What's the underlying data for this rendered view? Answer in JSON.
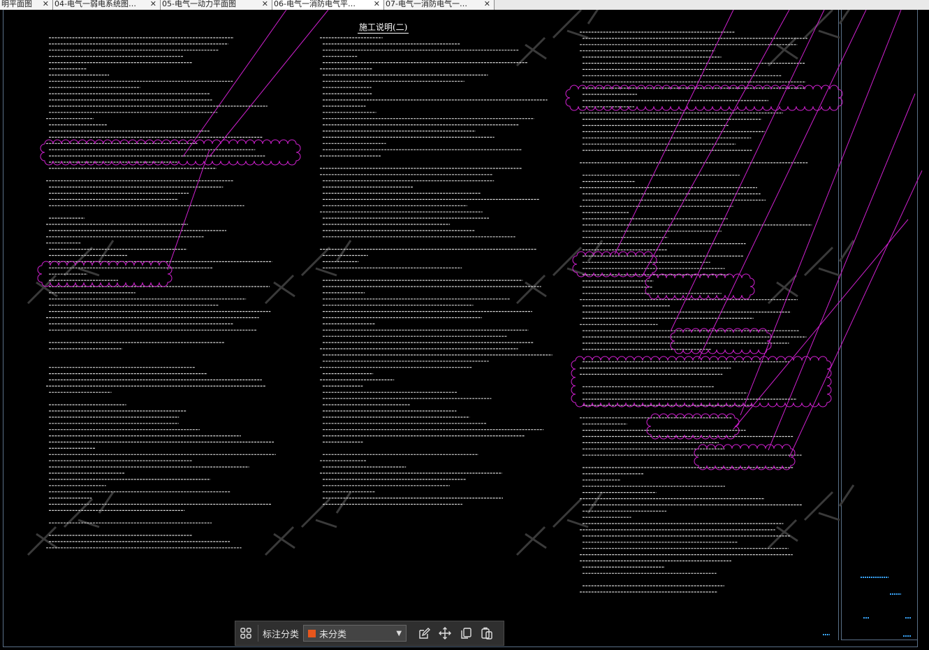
{
  "tabs": [
    {
      "label": "明平面图",
      "close": "✕"
    },
    {
      "label": "04-电气一弱电系统图…",
      "close": "✕"
    },
    {
      "label": "05-电气一动力平面图",
      "close": "✕"
    },
    {
      "label": "06-电气一消防电气平…",
      "close": "✕"
    },
    {
      "label": "07-电气一消防电气一…",
      "close": "✕"
    }
  ],
  "drawing": {
    "title": "施工说明(二)"
  },
  "toolbar": {
    "grid_icon": "grid-icon",
    "label": "标注分类",
    "category": {
      "value": "未分类",
      "color": "#e8561c"
    },
    "icons": [
      "edit-icon",
      "move-icon",
      "copy-icon",
      "paste-icon"
    ]
  },
  "colors": {
    "markup": "#d020d0",
    "frame": "#5a7088",
    "text": "#d8d8d8"
  }
}
